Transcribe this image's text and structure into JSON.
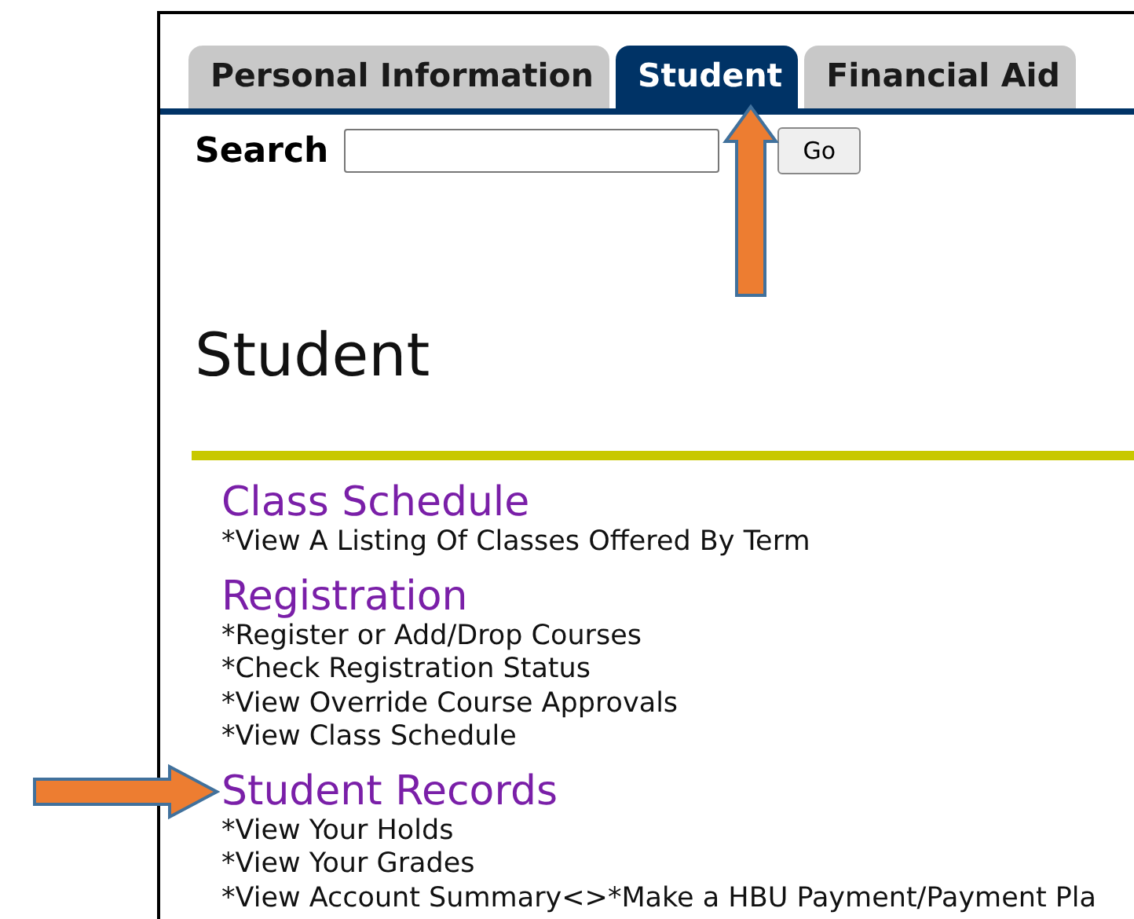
{
  "tabs": [
    {
      "label": "Personal Information",
      "selected": false
    },
    {
      "label": "Student",
      "selected": true
    },
    {
      "label": "Financial Aid",
      "selected": false
    }
  ],
  "search": {
    "label": "Search",
    "button": "Go"
  },
  "heading": "Student",
  "sections": [
    {
      "title": "Class Schedule",
      "links": [
        "*View A Listing Of Classes Offered By Term"
      ]
    },
    {
      "title": "Registration",
      "links": [
        "*Register or Add/Drop Courses",
        "*Check Registration Status",
        "*View Override Course Approvals",
        "*View Class Schedule"
      ]
    },
    {
      "title": "Student Records",
      "links": [
        "*View Your Holds",
        "*View Your Grades",
        "*View Account Summary<>*Make a HBU Payment/Payment Pla"
      ]
    }
  ]
}
